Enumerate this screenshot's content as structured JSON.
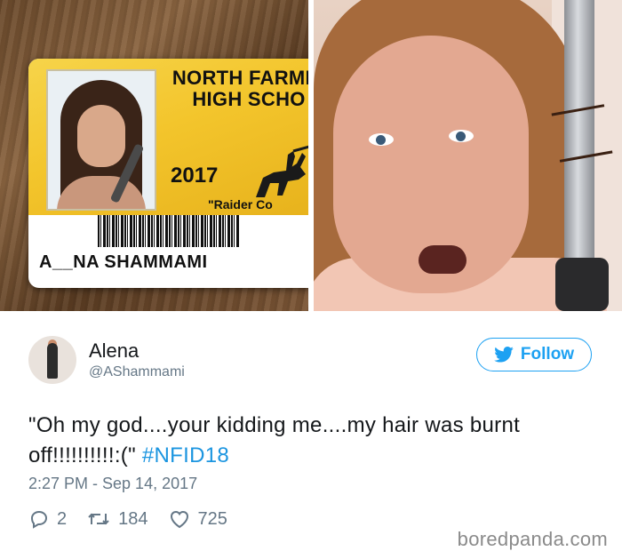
{
  "photos": {
    "id_card": {
      "school_line1": "NORTH FARMIN",
      "school_line2": "HIGH SCHO",
      "year": "2017",
      "motto": "\"Raider  Co",
      "name": "A__NA SHAMMAMI"
    }
  },
  "tweet": {
    "display_name": "Alena",
    "handle": "@AShammami",
    "follow_label": "Follow",
    "text": "\"Oh my god....your kidding me....my hair was burnt off!!!!!!!!!!:(\" ",
    "hashtag": "#NFID18",
    "timestamp": "2:27 PM - Sep 14, 2017",
    "replies": "2",
    "retweets": "184",
    "likes": "725"
  },
  "watermark": "boredpanda.com",
  "colors": {
    "accent": "#1da1f2",
    "hashtag": "#1b95e0",
    "muted": "#657786"
  },
  "icons": [
    "twitter-bird-icon",
    "reply-icon",
    "retweet-icon",
    "heart-icon"
  ]
}
